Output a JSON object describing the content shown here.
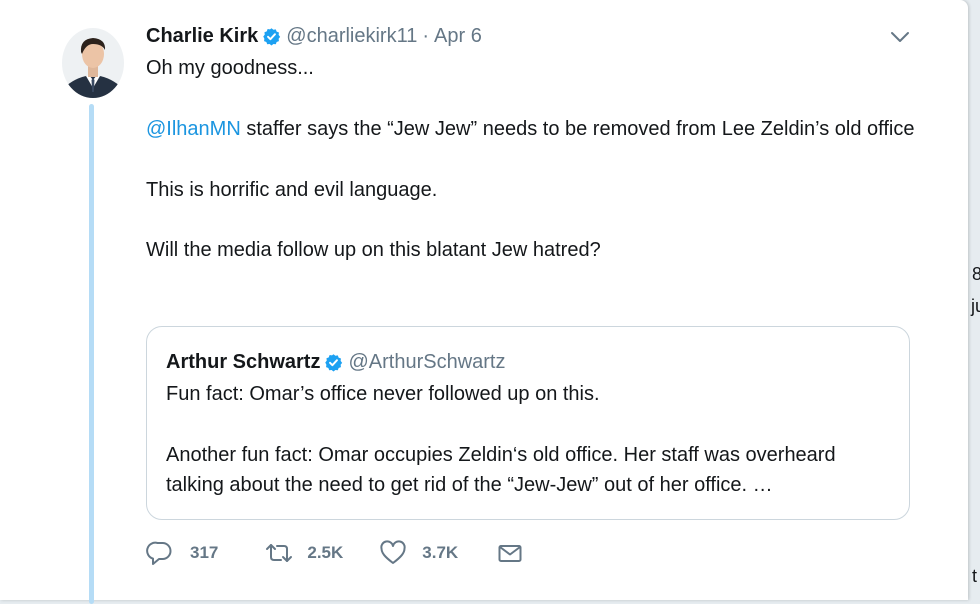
{
  "tweet": {
    "author_name": "Charlie Kirk",
    "author_handle": "@charliekirk11",
    "separator": "·",
    "date": "Apr 6",
    "line1": "Oh my goodness...",
    "mention": "@IlhanMN",
    "line2_rest": " staffer says the “Jew Jew” needs to be removed from Lee Zeldin’s old office",
    "line3": "This is horrific and evil language.",
    "line4": "Will the media follow up on this blatant Jew hatred?"
  },
  "quoted_tweet": {
    "author_name": "Arthur Schwartz",
    "author_handle": "@ArthurSchwartz",
    "line1": "Fun fact: Omar’s office never followed up on this.",
    "line2": "Another fun fact: Omar occupies Zeldin‘s old office. Her staff was overheard talking about the need to get rid of the “Jew-Jew” out of her office. …"
  },
  "actions": {
    "reply_count": "317",
    "retweet_count": "2.5K",
    "like_count": "3.7K"
  },
  "background_edge": {
    "glyph_1": "8",
    "glyph_2": "ju",
    "glyph_3": "t"
  },
  "icons": {
    "verified": "verified-badge-icon",
    "caret": "chevron-down-icon",
    "reply": "reply-icon",
    "retweet": "retweet-icon",
    "like": "heart-icon",
    "dm": "envelope-icon"
  },
  "colors": {
    "link_blue": "#1b95e0",
    "verified_blue": "#1da1f2",
    "thread_line": "#b5dcf6",
    "secondary_text": "#657786",
    "quote_border": "#ccd6dd",
    "page_background": "#e6ecf0"
  }
}
